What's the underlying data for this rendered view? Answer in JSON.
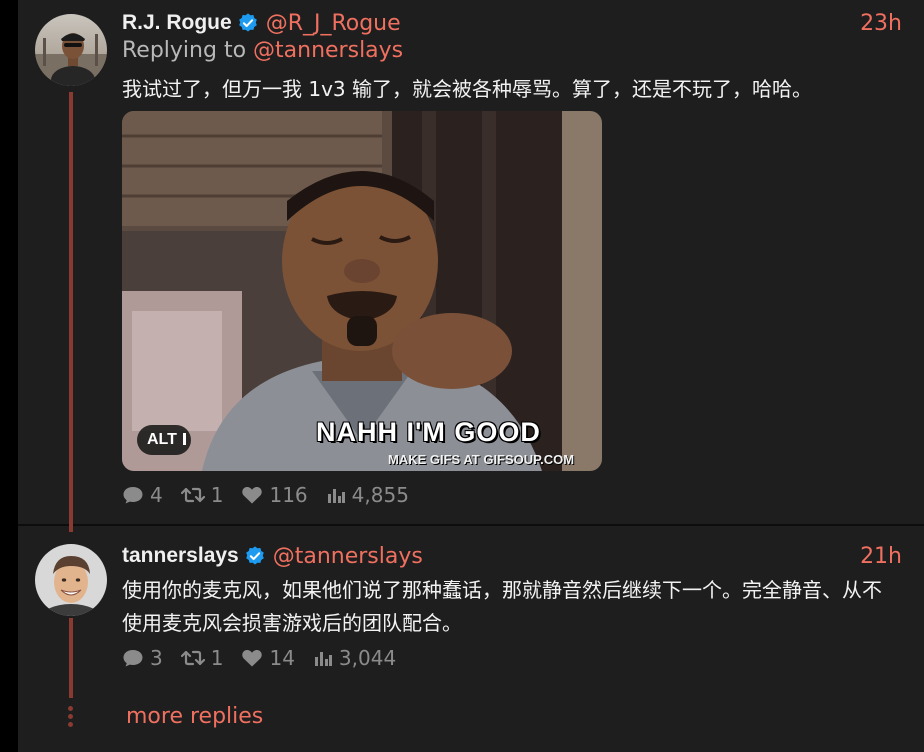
{
  "colors": {
    "accent": "#f07060",
    "thread_line": "#8a3a30",
    "panel_bg": "#1e1e1e",
    "verified": "#1d9bf0"
  },
  "tweets": [
    {
      "display_name": "R.J. Rogue",
      "handle": "@R_J_Rogue",
      "time": "23h",
      "reply_prefix": "Replying to",
      "reply_to": "@tannerslays",
      "text": "我试过了，但万一我 1v3 输了，就会被各种辱骂。算了，还是不玩了，哈哈。",
      "media": {
        "caption": "NAHH I'M GOOD",
        "watermark": "MAKE GIFS AT GIFSOUP.COM",
        "alt_label": "ALT"
      },
      "stats": {
        "replies": "4",
        "retweets": "1",
        "likes": "116",
        "views": "4,855"
      }
    },
    {
      "display_name": "tannerslays",
      "handle": "@tannerslays",
      "time": "21h",
      "text": "使用你的麦克风，如果他们说了那种蠢话，那就静音然后继续下一个。完全静音、从不使用麦克风会损害游戏后的团队配合。",
      "stats": {
        "replies": "3",
        "retweets": "1",
        "likes": "14",
        "views": "3,044"
      }
    }
  ],
  "more_replies_label": "more replies"
}
